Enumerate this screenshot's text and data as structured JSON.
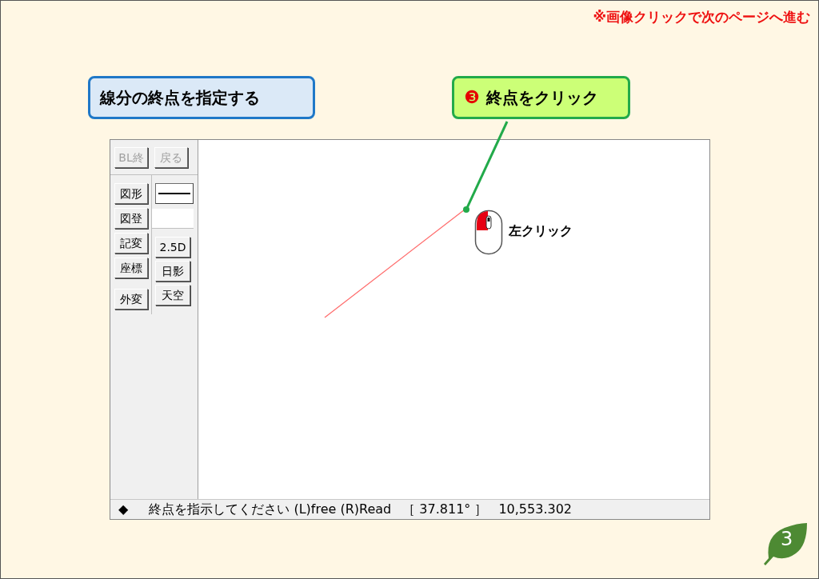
{
  "page_notice": "※画像クリックで次のページへ進む",
  "step_title": "線分の終点を指定する",
  "callout": {
    "number": "❸",
    "text": "終点をクリック"
  },
  "toolbar": {
    "top_buttons": [
      {
        "label": "BL終",
        "disabled": true
      },
      {
        "label": "戻る",
        "disabled": true
      }
    ],
    "left_buttons": [
      {
        "label": "図形",
        "disabled": false
      },
      {
        "label": "図登",
        "disabled": false
      },
      {
        "label": "記変",
        "disabled": false
      },
      {
        "label": "座標",
        "disabled": false
      },
      {
        "label": "外変",
        "disabled": false
      }
    ],
    "right_buttons": [
      {
        "label": "2.5D",
        "disabled": false
      },
      {
        "label": "日影",
        "disabled": false
      },
      {
        "label": "天空",
        "disabled": false
      }
    ]
  },
  "canvas": {
    "mouse_label": "左クリック"
  },
  "status_bar": {
    "marker": "◆",
    "message": "終点を指示してください (L)free (R)Read",
    "angle": "［ 37.811° ］",
    "value": "10,553.302"
  },
  "page_number": "3"
}
